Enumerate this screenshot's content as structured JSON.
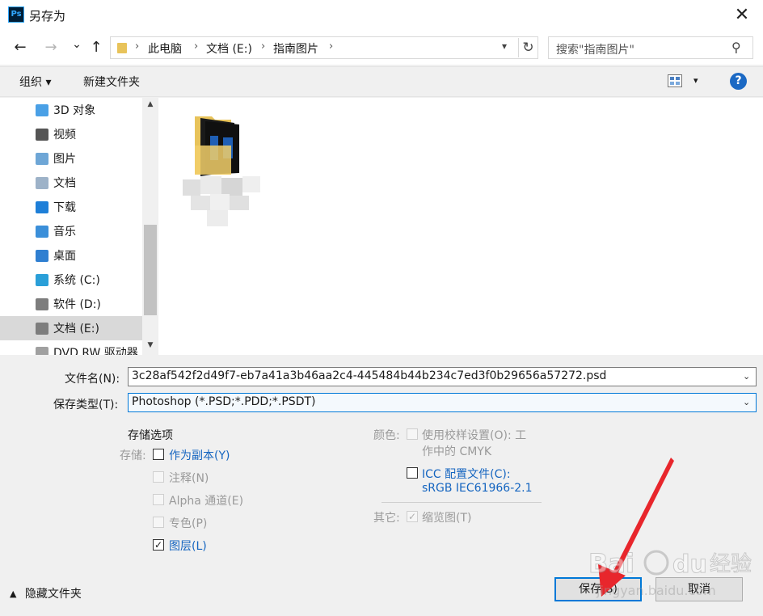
{
  "window": {
    "app_icon": "photoshop-icon",
    "app_icon_text": "Ps",
    "title": "另存为",
    "close_glyph": "✕"
  },
  "nav": {
    "back": "←",
    "forward": "→",
    "recent": "⌄",
    "up": "↑",
    "breadcrumb": [
      "此电脑",
      "文档 (E:)",
      "指南图片"
    ],
    "search_placeholder": "搜索\"指南图片\""
  },
  "toolbar": {
    "organize_label": "组织 ▾",
    "new_folder_label": "新建文件夹",
    "help_label": "?"
  },
  "sidebar": {
    "items": [
      {
        "label": "3D 对象",
        "icon": "3d-objects-icon",
        "color": "#4aa0e6",
        "selected": false
      },
      {
        "label": "视频",
        "icon": "video-icon",
        "color": "#555555",
        "selected": false
      },
      {
        "label": "图片",
        "icon": "pictures-icon",
        "color": "#6ea6d6",
        "selected": false
      },
      {
        "label": "文档",
        "icon": "documents-icon",
        "color": "#9db2c8",
        "selected": false
      },
      {
        "label": "下载",
        "icon": "downloads-icon",
        "color": "#1e7fd8",
        "selected": false
      },
      {
        "label": "音乐",
        "icon": "music-icon",
        "color": "#3b8fd9",
        "selected": false
      },
      {
        "label": "桌面",
        "icon": "desktop-icon",
        "color": "#2f7fd1",
        "selected": false
      },
      {
        "label": "系统 (C:)",
        "icon": "windows-drive-icon",
        "color": "#2a9fd8",
        "selected": false
      },
      {
        "label": "软件 (D:)",
        "icon": "drive-icon",
        "color": "#7d7d7d",
        "selected": false
      },
      {
        "label": "文档 (E:)",
        "icon": "drive-icon",
        "color": "#7d7d7d",
        "selected": true
      },
      {
        "label": "DVD RW 驱动器",
        "icon": "dvd-drive-icon",
        "color": "#a0a0a0",
        "selected": false
      }
    ]
  },
  "form": {
    "filename_label": "文件名(N):",
    "filename_value": "3c28af542f2d49f7-eb7a41a3b46aa2c4-445484b44b234c7ed3f0b29656a57272.psd",
    "filetype_label": "保存类型(T):",
    "filetype_value": "Photoshop (*.PSD;*.PDD;*.PSDT)"
  },
  "options": {
    "section_title": "存储选项",
    "storage_label": "存储:",
    "as_copy": "作为副本(Y)",
    "notes": "注释(N)",
    "alpha": "Alpha 通道(E)",
    "spot": "专色(P)",
    "layers": "图层(L)",
    "color_label": "颜色:",
    "proof_line1": "使用校样设置(O):  工",
    "proof_line2": "作中的 CMYK",
    "icc_line1": "ICC 配置文件(C):",
    "icc_line2": "sRGB IEC61966-2.1",
    "other_label": "其它:",
    "thumbnail": "缩览图(T)",
    "check_mark": "✓"
  },
  "footer": {
    "hide_folders": "隐藏文件夹",
    "save": "保存(S)",
    "cancel": "取消"
  },
  "colors": {
    "accent": "#0078d7",
    "link": "#1565c0",
    "annotation_arrow": "#e8262c",
    "folder": "#e8c35a"
  }
}
